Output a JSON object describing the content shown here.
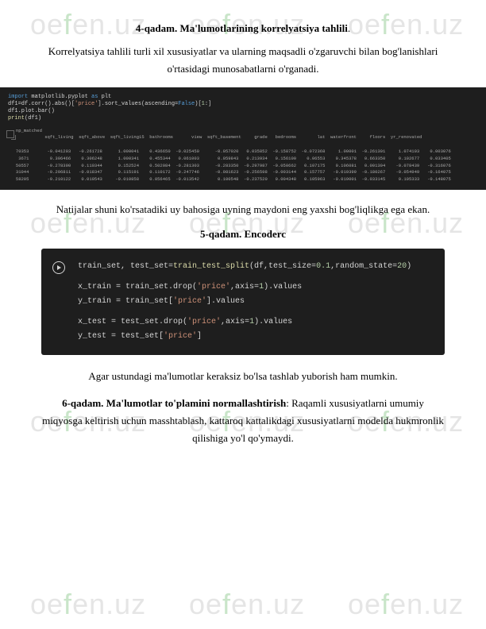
{
  "watermark_text": "oefen.uz",
  "step4": {
    "title_bold": "4-qadam. Ma'lumotlarining korrelyatsiya tahlili",
    "title_after": ".",
    "para": "Korrelyatsiya tahlili turli xil xususiyatlar va ularning maqsadli o'zgaruvchi bilan bog'lanishlari o'rtasidagi munosabatlarni o'rganadi."
  },
  "code1": {
    "line1": "import matplotlib.pyplot as plt",
    "line2": "df1=df.corr().abs()['price'].sort_values(ascending=False)[1:]",
    "line3": "df1.plot.bar()",
    "line4": "print(df1)",
    "table_label": "np_matched",
    "table": {
      "headers": [
        "",
        "sqft_living",
        "sqft_above",
        "sqft_living15",
        "bathrooms",
        "view",
        "sqft_basement",
        "grade",
        "bedrooms",
        "lat",
        "waterfront",
        "floors",
        "yr_renovated"
      ],
      "rows": [
        [
          "70353",
          "-0.041203",
          "-0.261728",
          "1.000041",
          "0.436650",
          "-0.025450",
          "-0.057020",
          "0.035852",
          "-0.158752",
          "-0.072368",
          "1.00001",
          "-0.261301",
          "1.074103",
          "0.003076"
        ],
        [
          "3671",
          "0.306466",
          "0.306248",
          "1.000341",
          "0.455344",
          "0.061003",
          "0.059843",
          "0.213934",
          "0.156100",
          "0.06553",
          "0.345378",
          "0.663350",
          "0.102677",
          "0.033405"
        ],
        [
          "50557",
          "-0.278390",
          "0.110344",
          "0.152524",
          "0.502084",
          "-0.281303",
          "-0.283350",
          "-0.297987",
          "-0.050662",
          "0.107175",
          "0.106081",
          "0.001304",
          "-0.078439",
          "-0.316076"
        ],
        [
          "31044",
          "-0.296811",
          "-0.018347",
          "0.115191",
          "0.110172",
          "-0.247746",
          "-0.081623",
          "-0.256598",
          "-0.003144",
          "0.157757",
          "-0.019399",
          "-0.180267",
          "-0.054949",
          "-0.164075"
        ],
        [
          "58205",
          "-0.210122",
          "0.019543",
          "-0.010858",
          "0.056465",
          "-0.013542",
          "0.100548",
          "-0.237520",
          "0.004348",
          "0.105963",
          "-0.019001",
          "-0.033145",
          "0.105333",
          "-0.148075"
        ]
      ]
    }
  },
  "results_para": "Natijalar shuni ko'rsatadiki uy bahosiga uyning maydoni eng yaxshi bog'liqlikga ega ekan.",
  "step5": {
    "title": "5-qadam. Encoderc"
  },
  "code2": {
    "l1a": "train_set, test_set=",
    "l1b": "train_test_split",
    "l1c": "(df,test_size=",
    "l1d": "0.1",
    "l1e": ",random_state=",
    "l1f": "20",
    "l1g": ")",
    "l2a": "x_train = train_set.drop(",
    "l2b": "'price'",
    "l2c": ",axis=",
    "l2d": "1",
    "l2e": ").values",
    "l3a": "y_train = train_set[",
    "l3b": "'price'",
    "l3c": "].values",
    "l4a": "x_test = test_set.drop(",
    "l4b": "'price'",
    "l4c": ",axis=",
    "l4d": "1",
    "l4e": ").values",
    "l5a": "y_test = test_set[",
    "l5b": "'price'",
    "l5c": "]"
  },
  "after_code2": "Agar ustundagi ma'lumotlar keraksiz bo'lsa tashlab yuborish ham mumkin.",
  "step6": {
    "title_bold": "6-qadam. Ma'lumotlar to'plamini normallashtirish",
    "title_after": ": Raqamli xususiyatlarni umumiy miqyosga keltirish uchun masshtablash, kattaroq kattalikdagi xususiyatlarni modelda hukmronlik qilishiga yo'l qo'ymaydi."
  }
}
